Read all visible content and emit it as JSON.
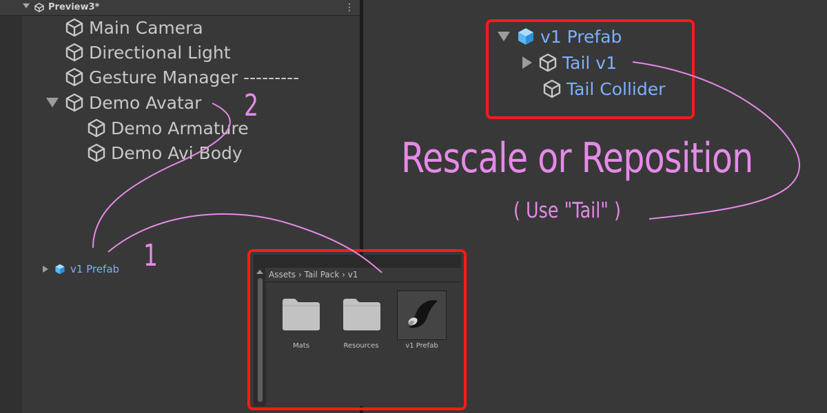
{
  "hierarchy": {
    "scene_title": "Preview3*",
    "items": [
      {
        "label": "Main Camera"
      },
      {
        "label": "Directional Light"
      },
      {
        "label": "Gesture Manager ---------"
      },
      {
        "label": "Demo Avatar"
      },
      {
        "label": "Demo Armature"
      },
      {
        "label": "Demo Avi Body"
      }
    ],
    "dropped_item": "v1 Prefab"
  },
  "prefab_hierarchy": {
    "root": "v1 Prefab",
    "children": [
      {
        "label": "Tail v1"
      },
      {
        "label": "Tail Collider"
      }
    ]
  },
  "project": {
    "breadcrumb": [
      "Assets",
      "Tail Pack",
      "v1"
    ],
    "assets": [
      {
        "label": "Mats",
        "icon": "folder-icon"
      },
      {
        "label": "Resources",
        "icon": "folder-icon"
      },
      {
        "label": "v1 Prefab",
        "icon": "prefab-thumbnail-icon"
      }
    ]
  },
  "annotations": {
    "step1": "1",
    "step2": "2",
    "instruction": "Rescale or Reposition",
    "instruction_sub": "( Use \"Tail\" )"
  },
  "colors": {
    "annotation": "#e58ae8",
    "highlight_box": "#ff1a1a",
    "prefab_blue": "#7cb0ff"
  }
}
